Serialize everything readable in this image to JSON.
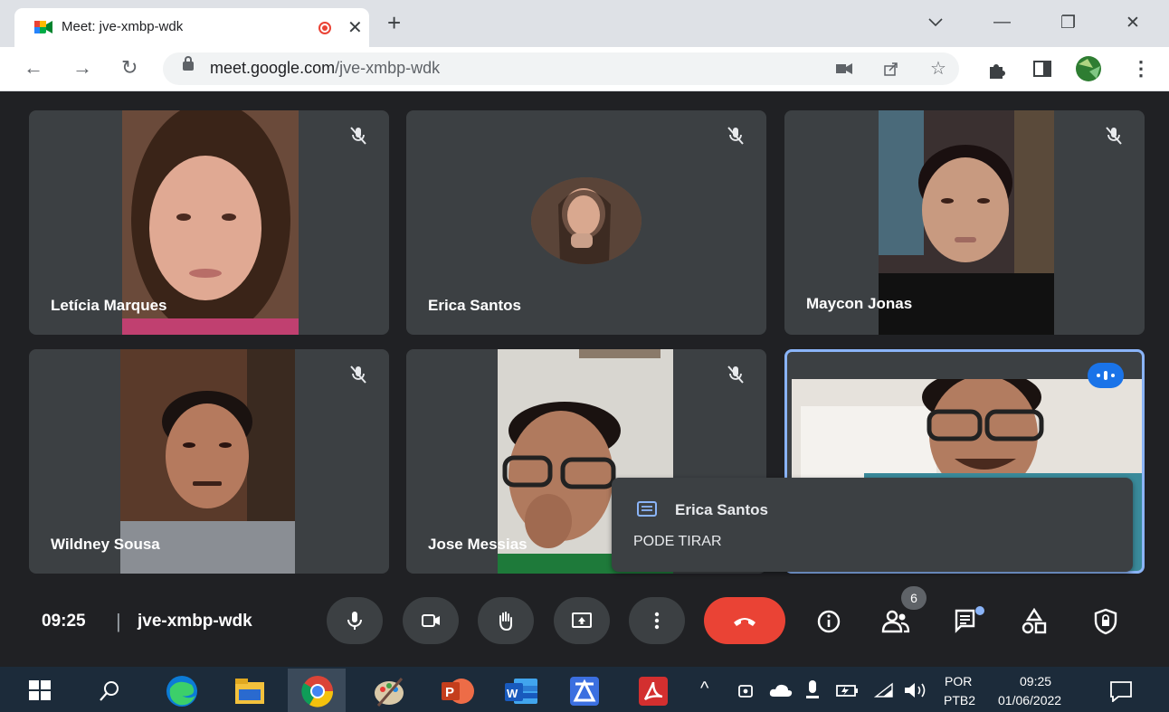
{
  "browser": {
    "tab_title": "Meet: jve-xmbp-wdk",
    "tab_close": "✕",
    "new_tab": "+",
    "url_host": "meet.google.com",
    "url_path": "/jve-xmbp-wdk",
    "window_minimize": "—",
    "window_restore": "❐",
    "window_close": "✕"
  },
  "participants": [
    {
      "name": "Letícia Marques",
      "muted": true
    },
    {
      "name": "Erica Santos",
      "muted": true
    },
    {
      "name": "Maycon Jonas",
      "muted": true
    },
    {
      "name": "Wildney Sousa",
      "muted": true
    },
    {
      "name": "Jose Messias",
      "muted": true
    },
    {
      "name": "",
      "speaking": true
    }
  ],
  "chat_popup": {
    "sender": "Erica Santos",
    "message": "PODE TIRAR"
  },
  "bottom_bar": {
    "time": "09:25",
    "separator": "|",
    "meeting_code": "jve-xmbp-wdk",
    "people_count": "6"
  },
  "taskbar": {
    "language": "POR",
    "layout": "PTB2",
    "clock_time": "09:25",
    "clock_date": "01/06/2022"
  },
  "colors": {
    "meet_bg": "#202124",
    "tile_bg": "#3c4043",
    "hangup_red": "#ea4335",
    "active_blue": "#8ab4f8",
    "speaking_blue": "#1a73e8"
  }
}
